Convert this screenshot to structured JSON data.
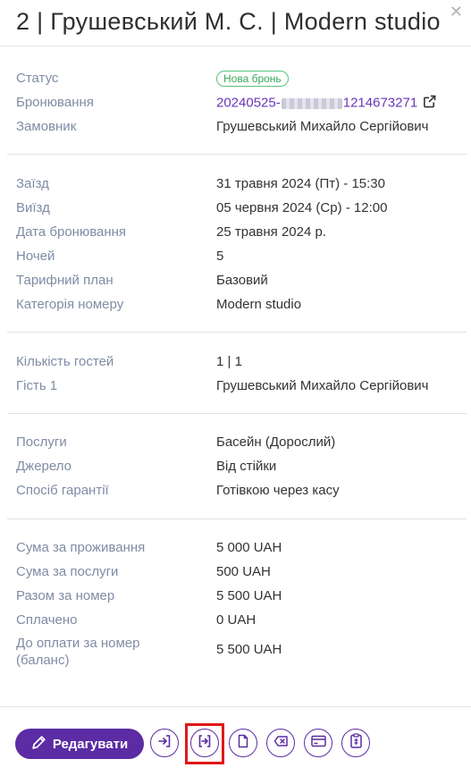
{
  "header": {
    "title": "2 | Грушевський М. С. | Modern studio",
    "close_icon": "close-icon"
  },
  "booking": {
    "status_label": "Статус",
    "status_value": "Нова бронь",
    "booking_label": "Бронювання",
    "booking_prefix": "20240525-",
    "booking_suffix": "1214673271",
    "customer_label": "Замовник",
    "customer_value": "Грушевський Михайло Сергійович"
  },
  "stay": {
    "checkin_label": "Заїзд",
    "checkin_value": "31 травня 2024 (Пт) - 15:30",
    "checkout_label": "Виїзд",
    "checkout_value": "05 червня 2024 (Ср) - 12:00",
    "date_label": "Дата бронювання",
    "date_value": "25 травня 2024 р.",
    "nights_label": "Ночей",
    "nights_value": "5",
    "plan_label": "Тарифний план",
    "plan_value": "Базовий",
    "category_label": "Категорія номеру",
    "category_value": "Modern studio"
  },
  "guests": {
    "count_label": "Кількість гостей",
    "count_value": "1 | 1",
    "guest_label": "Гість 1",
    "guest_value": "Грушевський Михайло Сергійович"
  },
  "services": {
    "services_label": "Послуги",
    "services_value": "Басейн (Дорослий)",
    "source_label": "Джерело",
    "source_value": "Від стійки",
    "guarantee_label": "Спосіб гарантії",
    "guarantee_value": "Готівкою через касу"
  },
  "payment": {
    "accommodation_label": "Сума за проживання",
    "accommodation_value": "5 000 UAH",
    "services_sum_label": "Сума за послуги",
    "services_sum_value": "500 UAH",
    "total_label": "Разом за номер",
    "total_value": "5 500 UAH",
    "paid_label": "Сплачено",
    "paid_value": "0 UAH",
    "due_label_line1": "До оплати за номер",
    "due_label_line2": "(баланс)",
    "due_value": "5 500 UAH"
  },
  "footer": {
    "edit_label": "Редагувати",
    "icons": [
      "pencil-icon",
      "check-in-icon",
      "move-icon",
      "document-icon",
      "cancel-icon",
      "card-icon",
      "clipboard-icon"
    ]
  },
  "colors": {
    "accent": "#5b2ca3",
    "label": "#7f8ca5",
    "badge": "#38a85a",
    "link": "#6a36b8",
    "highlight": "#e01818"
  }
}
